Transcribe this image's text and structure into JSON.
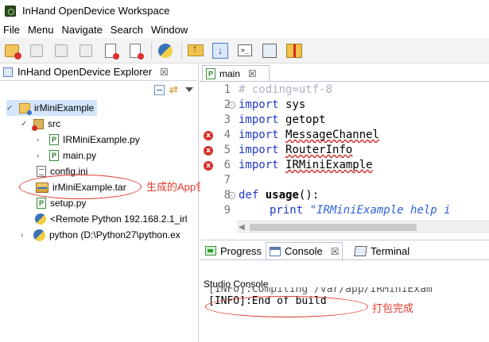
{
  "window": {
    "title": "InHand OpenDevice Workspace"
  },
  "menu": [
    "File",
    "Menu",
    "Navigate",
    "Search",
    "Window"
  ],
  "explorer": {
    "tab_title": "InHand OpenDevice Explorer",
    "tab_close": "☒",
    "tree": {
      "project": "irMiniExample",
      "src": "src",
      "file_irmini": "IRMiniExample.py",
      "file_main": "main.py",
      "file_config": "config.ini",
      "file_tar": "irMiniExample.tar",
      "file_setup": "setup.py",
      "remote_python": "<Remote Python 192.168.2.1_irl",
      "python_interp": "python  (D:\\Python27\\python.ex"
    },
    "annotation_tar": "生成的App包"
  },
  "editor": {
    "tab_label": "main",
    "tab_close": "☒",
    "lines": [
      {
        "num": "1",
        "comment": "# coding=utf-8"
      },
      {
        "num": "2",
        "kw": "import",
        "name": "sys"
      },
      {
        "num": "3",
        "kw": "import",
        "name": "getopt"
      },
      {
        "num": "4",
        "kw": "import",
        "name": "MessageChannel"
      },
      {
        "num": "5",
        "kw": "import",
        "name": "RouterInfo"
      },
      {
        "num": "6",
        "kw": "import",
        "name": "IRMiniExample"
      },
      {
        "num": "7"
      },
      {
        "num": "8",
        "kw": "def",
        "fn": "usage",
        "rest": "():"
      },
      {
        "num": "9",
        "kw": "print",
        "str": "\"IRMiniExample help i"
      }
    ],
    "error_marker": "x"
  },
  "bottom": {
    "tabs": {
      "progress": "Progress",
      "console": "Console",
      "terminal": "Terminal"
    },
    "console_close": "☒",
    "studio_label": "Studio Console",
    "clipped_line": "[INFO]:Compiling /var/app/IRMiniExam",
    "last_line": "[INFO]:End of build",
    "annotation": "打包完成"
  },
  "colors": {
    "annotation": "#e33a2b",
    "keyword": "#1f39c9",
    "error": "#d6312b",
    "selection": "#d3e6fb"
  }
}
